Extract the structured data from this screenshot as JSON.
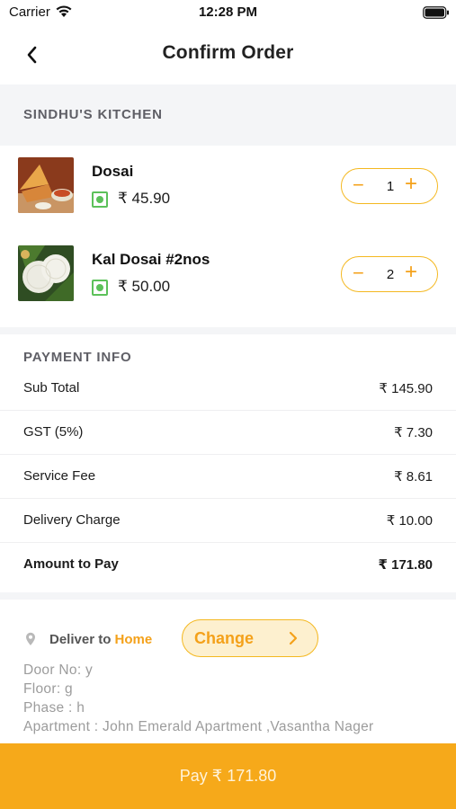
{
  "status_bar": {
    "carrier": "Carrier",
    "time": "12:28 PM"
  },
  "nav": {
    "title": "Confirm Order",
    "back_icon": "chevron-left-icon"
  },
  "restaurant": {
    "name": "SINDHU'S KITCHEN"
  },
  "items": [
    {
      "name": "Dosai",
      "price": "₹ 45.90",
      "quantity": "1",
      "diet": "veg"
    },
    {
      "name": "Kal Dosai #2nos",
      "price": "₹ 50.00",
      "quantity": "2",
      "diet": "veg"
    }
  ],
  "stepper": {
    "minus": "−",
    "plus": "+"
  },
  "payment": {
    "heading": "PAYMENT INFO",
    "rows": [
      {
        "label": "Sub Total",
        "value": "₹ 145.90"
      },
      {
        "label": "GST (5%)",
        "value": "₹ 7.30"
      },
      {
        "label": "Service Fee",
        "value": "₹ 8.61"
      },
      {
        "label": "Delivery Charge",
        "value": "₹ 10.00"
      },
      {
        "label": "Amount to Pay",
        "value": "₹ 171.80"
      }
    ]
  },
  "delivery": {
    "prefix": "Deliver to",
    "place": "Home",
    "change_label": "Change",
    "address_lines": [
      "Door No: y",
      "Floor: g",
      "Phase : h",
      "Apartment : John Emerald Apartment ,Vasantha Nager"
    ]
  },
  "pay_button": {
    "label": "Pay ₹ 171.80"
  },
  "colors": {
    "accent": "#f6a91a",
    "accent_light": "#fdf0cf",
    "veg": "#5cc15a",
    "band": "#f4f5f7"
  }
}
